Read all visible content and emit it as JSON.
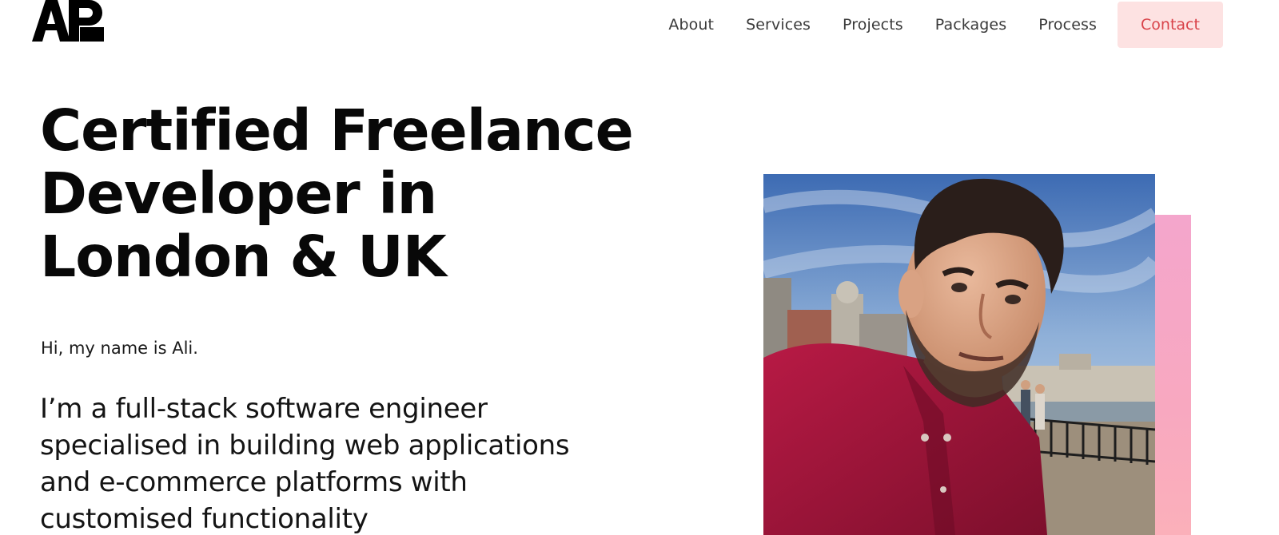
{
  "header": {
    "logo_text": "AP",
    "nav": [
      {
        "label": "About"
      },
      {
        "label": "Services"
      },
      {
        "label": "Projects"
      },
      {
        "label": "Packages"
      },
      {
        "label": "Process"
      }
    ],
    "contact_label": "Contact"
  },
  "hero": {
    "title_lines": [
      "Certified Freelance",
      "Developer in",
      "London & UK"
    ],
    "greeting": "Hi, my name is Ali.",
    "tagline_lines": [
      "I’m a full-stack software engineer",
      "specialised in building web applications",
      "and e-commerce platforms with",
      "customised functionality"
    ]
  },
  "colors": {
    "contact_bg": "#fde2e2",
    "contact_text": "#d9434a",
    "accent_pink": "#f4a6cc",
    "shirt": "#9c1438"
  },
  "icons": {
    "logo": "ap-monogram-logo"
  }
}
